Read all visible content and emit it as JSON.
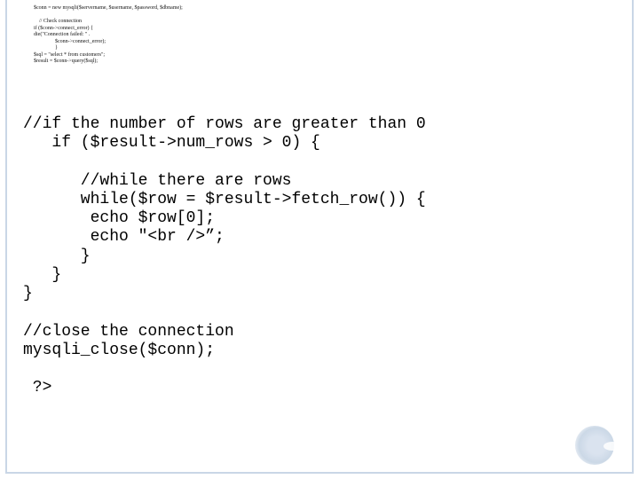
{
  "top_block": "$conn = new mysqli($servername, $username, $password, $dbname);\n\n    // Check connection\nif ($conn->connect_error) {\ndie(\"Connection failed: \" .\n                $conn->connect_error);\n                }\n$sql = \"select * from customers\";\n$result = $conn->query($sql);",
  "main_block": "//if the number of rows are greater than 0\n   if ($result->num_rows > 0) {\n\n      //while there are rows\n      while($row = $result->fetch_row()) {\n       echo $row[0];\n       echo \"<br />”;\n      }\n   }\n}\n\n//close the connection\nmysqli_close($conn);\n\n ?>"
}
